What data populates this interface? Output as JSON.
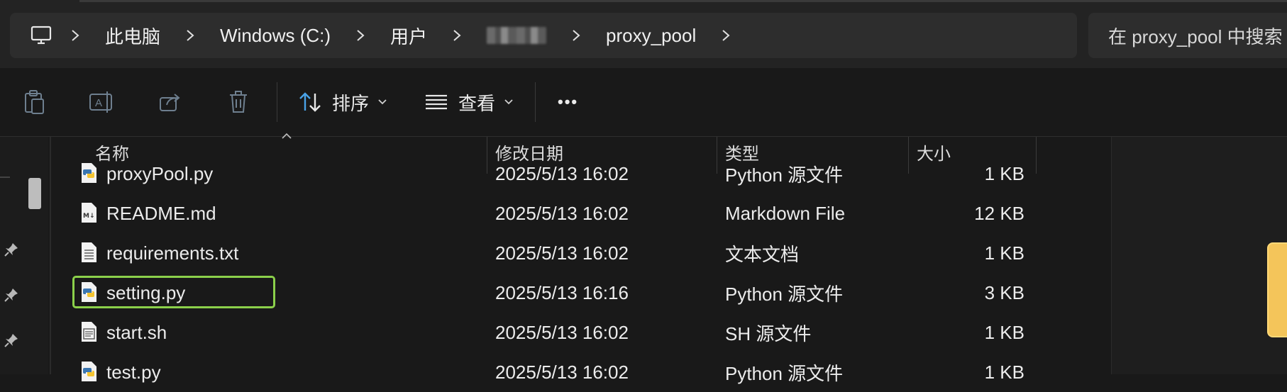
{
  "address_bar": {
    "segments": [
      "此电脑",
      "Windows (C:)",
      "用户",
      "proxy_pool"
    ],
    "icons": {
      "root": "computer-icon",
      "separator": "chevron-right-icon"
    }
  },
  "search": {
    "placeholder": "在 proxy_pool 中搜索"
  },
  "toolbar": {
    "sort_label": "排序",
    "view_label": "查看",
    "more_label": "•••",
    "icons": [
      "paste-icon",
      "rename-icon",
      "share-icon",
      "delete-icon",
      "sort-icon",
      "view-icon",
      "chevron-down-icon",
      "more-icon"
    ]
  },
  "columns": {
    "name": "名称",
    "modified": "修改日期",
    "type": "类型",
    "size": "大小"
  },
  "files": [
    {
      "name": "proxyPool.py",
      "modified": "2025/5/13 16:02",
      "type": "Python 源文件",
      "size": "1 KB",
      "icon": "python-file-icon"
    },
    {
      "name": "README.md",
      "modified": "2025/5/13 16:02",
      "type": "Markdown File",
      "size": "12 KB",
      "icon": "markdown-file-icon"
    },
    {
      "name": "requirements.txt",
      "modified": "2025/5/13 16:02",
      "type": "文本文档",
      "size": "1 KB",
      "icon": "text-file-icon"
    },
    {
      "name": "setting.py",
      "modified": "2025/5/13 16:16",
      "type": "Python 源文件",
      "size": "3 KB",
      "icon": "python-file-icon"
    },
    {
      "name": "start.sh",
      "modified": "2025/5/13 16:02",
      "type": "SH 源文件",
      "size": "1 KB",
      "icon": "shell-file-icon"
    },
    {
      "name": "test.py",
      "modified": "2025/5/13 16:02",
      "type": "Python 源文件",
      "size": "1 KB",
      "icon": "python-file-icon"
    }
  ],
  "highlight_color": "#8bd04a"
}
